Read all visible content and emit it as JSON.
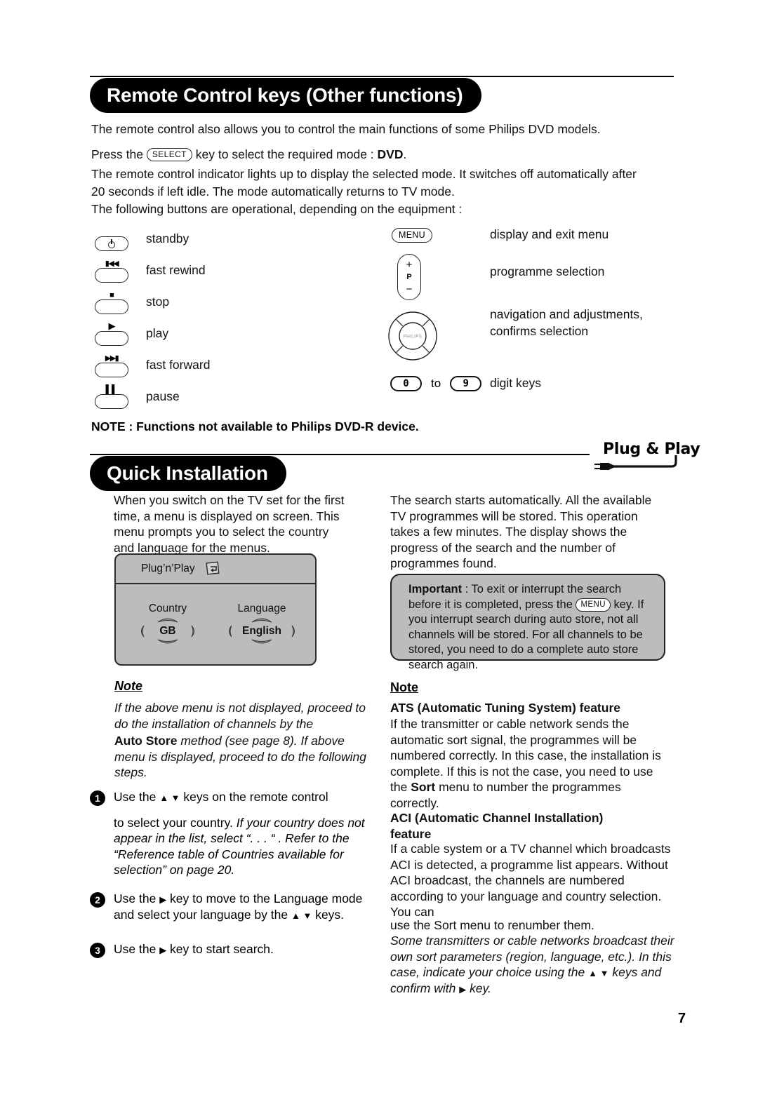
{
  "page": {
    "number": "7"
  },
  "section1": {
    "title": "Remote Control keys (Other functions)",
    "intro": "The remote control also allows you to control the main functions of some Philips DVD models.",
    "press_prefix": "Press the",
    "select_key": "SELECT",
    "press_suffix": "key to select the required mode :",
    "press_mode": "DVD",
    "press_period": ".",
    "para2": "The remote control indicator lights up to display the selected mode. It switches off automatically after 20 seconds if left idle. The mode automatically returns to TV mode.",
    "para3": "The following buttons are operational, depending on the equipment :",
    "left_keys": [
      {
        "glyph": "",
        "icon": "power-icon",
        "label": "standby"
      },
      {
        "glyph": "◀◀",
        "icon": "fast-rewind-icon",
        "label": "fast rewind"
      },
      {
        "glyph": "■",
        "icon": "stop-icon",
        "label": "stop"
      },
      {
        "glyph": "▶",
        "icon": "play-icon",
        "label": "play"
      },
      {
        "glyph": "▶▶",
        "icon": "fast-forward-icon",
        "label": "fast forward"
      },
      {
        "glyph": "▐▐",
        "icon": "pause-icon",
        "label": "pause"
      }
    ],
    "right_keys": {
      "menu_cap": "MENU",
      "menu_label": "display and exit menu",
      "p_plus": "+",
      "p_letter": "P",
      "p_minus": "−",
      "p_label": "programme selection",
      "nav_center": "PHILIPS",
      "nav_label_line1": "navigation and adjustments,",
      "nav_label_line2": "confirms selection",
      "digit_from": "0",
      "digit_to_word": "to",
      "digit_to": "9",
      "digit_label": "digit keys"
    },
    "note": "NOTE : Functions not available to Philips DVD-R device."
  },
  "section2": {
    "title": "Quick Installation",
    "logo": "Plug & Play",
    "left": {
      "intro": "When you switch on the TV set for the first time, a menu is displayed on screen. This menu prompts you to select the country and language for the menus.",
      "menu": {
        "title": "Plug’n’Play",
        "country_label": "Country",
        "country_value": "GB",
        "language_label": "Language",
        "language_value": "English"
      },
      "note_heading": "Note",
      "note_p1": "If the above menu is not displayed, proceed to do the installation of channels by the",
      "note_p2_bold": "Auto Store",
      "note_p2_rest": " method (see page 8). If above menu is displayed, proceed to do the following steps.",
      "steps": [
        {
          "num": "1",
          "line1_a": "Use the ",
          "line1_keys": "▲ ▼",
          "line1_b": " keys on the remote control",
          "line2": "to select your country. ",
          "line2_ital": "If your country does not appear in the list, select “. . . “ . Refer to the “Reference table of Countries available for selection” on page 20."
        },
        {
          "num": "2",
          "text_a": "Use the ",
          "key1": "▶",
          "text_b": " key to move to the Language mode and select your language by the ",
          "key2": "▲ ▼",
          "text_c": " keys."
        },
        {
          "num": "3",
          "text_a": "Use the ",
          "key1": "▶",
          "text_b": " key to start search."
        }
      ]
    },
    "right": {
      "intro": "The search starts automatically. All the available TV programmes will be stored. This operation takes a few minutes. The display shows the progress of the search and the number of programmes found.",
      "important": {
        "label": "Important",
        "text_a": " : To exit or interrupt the search before it is completed, press the ",
        "key": "MENU",
        "text_b": " key. If you interrupt search during auto store, not all channels will be stored. For all channels to be stored, you need to do a complete auto store search again."
      },
      "note_heading": "Note",
      "ats_heading": "ATS (Automatic Tuning System) feature",
      "ats_text_a": "If the transmitter or cable network sends the automatic sort signal, the programmes will be numbered correctly. In this case, the installation is complete. If this is not the case, you need to use the ",
      "ats_bold": "Sort",
      "ats_text_b": " menu to number the programmes correctly.",
      "aci_heading_line1": "ACI (Automatic Channel Installation)",
      "aci_heading_line2": "feature",
      "aci_text": "If a cable system or a TV channel which broadcasts ACI is detected, a programme list appears. Without ACI broadcast, the channels are numbered according to your language and country selection. You can",
      "aci_text2": "use the Sort menu to renumber them.",
      "aci_ital_a": "Some transmitters or cable networks broadcast their own sort parameters (region, language, etc.). In this case, indicate your choice using the ",
      "aci_ital_keys": "▲ ▼",
      "aci_ital_b": " keys and confirm with ",
      "aci_ital_key2": "▶",
      "aci_ital_c": " key."
    }
  },
  "colors": {
    "ink": "#000000",
    "panel_gray": "#bcbcbc",
    "paper": "#ffffff"
  }
}
